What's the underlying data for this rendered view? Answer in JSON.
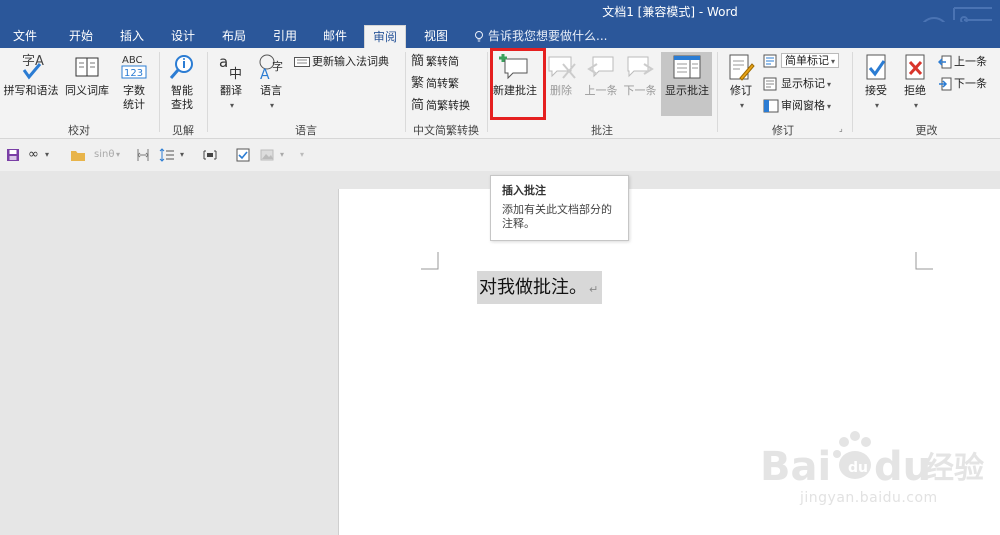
{
  "window": {
    "title": "文档1 [兼容模式] - Word"
  },
  "tabs": [
    "文件",
    "开始",
    "插入",
    "设计",
    "布局",
    "引用",
    "邮件",
    "审阅",
    "视图"
  ],
  "tell_me": "告诉我您想要做什么...",
  "ribbon": {
    "proofing": {
      "spelling": "拼写和语法",
      "thesaurus": "同义词库",
      "wordcount_line1": "字数",
      "wordcount_line2": "统计",
      "label": "校对"
    },
    "insights": {
      "smartlookup_line1": "智能",
      "smartlookup_line2": "查找",
      "label": "见解"
    },
    "language": {
      "translate": "翻译",
      "language": "语言",
      "update_ime": "更新输入法词典",
      "label": "语言"
    },
    "chinese_conv": {
      "to_simplified": "繁转简",
      "to_traditional": "简转繁",
      "conversion": "简繁转换",
      "label": "中文简繁转换"
    },
    "comments": {
      "new": "新建批注",
      "delete": "删除",
      "previous": "上一条",
      "next": "下一条",
      "show": "显示批注",
      "label": "批注"
    },
    "tracking": {
      "track_changes": "修订",
      "markup": "简单标记",
      "show_markup": "显示标记",
      "reviewing_pane": "审阅窗格",
      "label": "修订"
    },
    "changes": {
      "accept": "接受",
      "reject": "拒绝",
      "previous": "上一条",
      "next": "下一条",
      "label": "更改"
    }
  },
  "qat": {
    "sin_label": "sinθ"
  },
  "tooltip": {
    "title": "插入批注",
    "body": "添加有关此文档部分的注释。"
  },
  "document": {
    "text": "对我做批注。",
    "para_mark": "↵"
  },
  "watermark": {
    "url": "jingyan.baidu.com"
  },
  "colors": {
    "accent": "#2b579a",
    "highlight": "#e52020",
    "selection": "#d8d8d8"
  }
}
